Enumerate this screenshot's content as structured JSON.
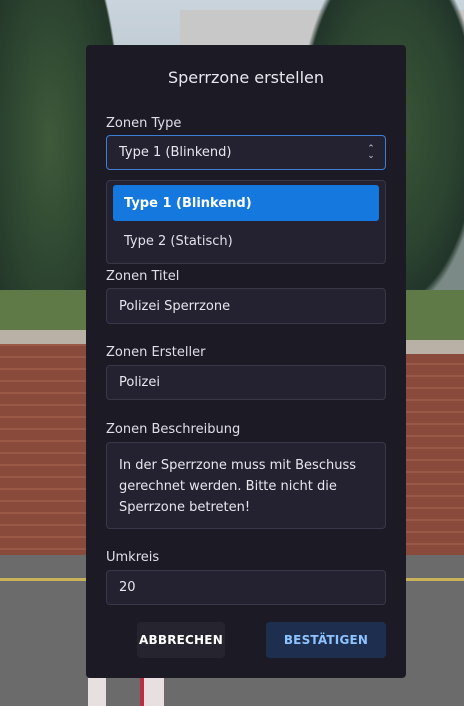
{
  "dialog": {
    "title": "Sperrzone erstellen",
    "zone_type": {
      "label": "Zonen Type",
      "selected": "Type 1 (Blinkend)",
      "options": [
        "Type 1 (Blinkend)",
        "Type 2 (Statisch)"
      ]
    },
    "zone_title": {
      "label": "Zonen Titel",
      "value": "Polizei Sperrzone"
    },
    "zone_creator": {
      "label": "Zonen Ersteller",
      "value": "Polizei"
    },
    "zone_description": {
      "label": "Zonen Beschreibung",
      "value": "In der Sperrzone muss mit Beschuss gerechnet werden. Bitte nicht die Sperrzone betreten!"
    },
    "radius": {
      "label": "Umkreis",
      "value": "20"
    },
    "buttons": {
      "cancel": "ABBRECHEN",
      "confirm": "BESTÄTIGEN"
    }
  },
  "colors": {
    "panel_bg": "#1c1a25",
    "field_bg": "#242230",
    "accent": "#1478de",
    "confirm_text": "#8ec3ff"
  },
  "icons": {
    "select_chevron": "chevron-up-down-icon"
  }
}
